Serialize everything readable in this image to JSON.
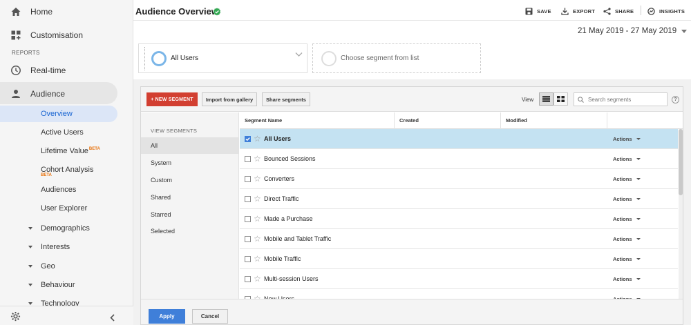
{
  "sidebar": {
    "home": "Home",
    "customisation": "Customisation",
    "reports_label": "REPORTS",
    "realtime": "Real-time",
    "audience": "Audience",
    "sub_items": {
      "overview": "Overview",
      "active_users": "Active Users",
      "lifetime_value": "Lifetime Value",
      "cohort_analysis": "Cohort Analysis",
      "audiences": "Audiences",
      "user_explorer": "User Explorer"
    },
    "beta_badge": "BETA",
    "groups": [
      "Demographics",
      "Interests",
      "Geo",
      "Behaviour",
      "Technology"
    ]
  },
  "header": {
    "title": "Audience Overview",
    "save": "SAVE",
    "export": "EXPORT",
    "share": "SHARE",
    "insights": "INSIGHTS"
  },
  "date_range": "21 May 2019 - 27 May 2019",
  "segment_picker": {
    "selected": "All Users",
    "placeholder": "Choose segment from list"
  },
  "segment_panel": {
    "new_segment": "+ NEW SEGMENT",
    "import_gallery": "Import from gallery",
    "share_segments": "Share segments",
    "view_label": "View",
    "search_placeholder": "Search segments",
    "help": "?",
    "view_segments_title": "VIEW SEGMENTS",
    "filters": [
      "All",
      "System",
      "Custom",
      "Shared",
      "Starred",
      "Selected"
    ],
    "columns": [
      "Segment Name",
      "Created",
      "Modified"
    ],
    "actions_label": "Actions",
    "rows": [
      {
        "name": "All Users",
        "checked": true
      },
      {
        "name": "Bounced Sessions",
        "checked": false
      },
      {
        "name": "Converters",
        "checked": false
      },
      {
        "name": "Direct Traffic",
        "checked": false
      },
      {
        "name": "Made a Purchase",
        "checked": false
      },
      {
        "name": "Mobile and Tablet Traffic",
        "checked": false
      },
      {
        "name": "Mobile Traffic",
        "checked": false
      },
      {
        "name": "Multi-session Users",
        "checked": false
      },
      {
        "name": "New Users",
        "checked": false
      }
    ],
    "apply": "Apply",
    "cancel": "Cancel"
  },
  "colors": {
    "new_segment_red": "#d23f31",
    "apply_blue": "#3f7fd9",
    "selected_row": "#c4e2f2",
    "verified_green": "#34a853"
  }
}
